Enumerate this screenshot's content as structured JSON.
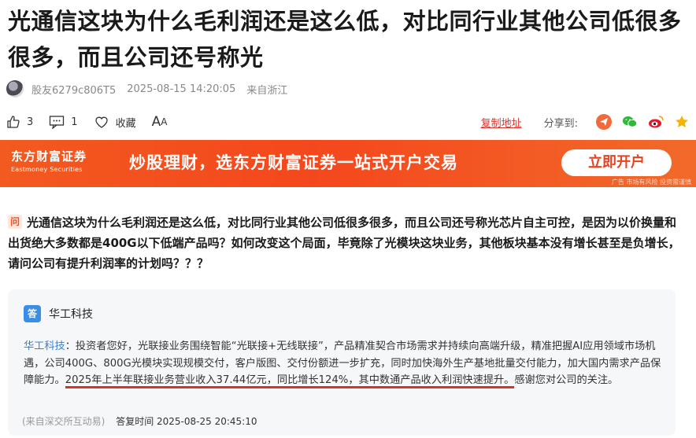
{
  "article": {
    "title": "光通信这块为什么毛利润还是这么低，对比同行业其他公司低很多很多，而且公司还号称光"
  },
  "meta": {
    "author": "股友6279c806T5",
    "datetime": "2025-08-15 14:20:05",
    "location": "来自浙江"
  },
  "actions": {
    "likes": "3",
    "comments": "1",
    "favorite_label": "收藏",
    "font_label": "A",
    "font_label_small": "A",
    "copy_link": "复制地址",
    "share_label": "分享到:"
  },
  "share_icons": [
    {
      "name": "paper-plane-icon",
      "color": "#f06a3c"
    },
    {
      "name": "wechat-icon",
      "color": "#2dbb35"
    },
    {
      "name": "weibo-icon",
      "color": "#e6162d"
    },
    {
      "name": "qzone-star-icon",
      "color": "#f4b400"
    }
  ],
  "banner": {
    "logo_cn": "东方财富证券",
    "logo_en": "Eastmoney Securities",
    "slogan": "炒股理财，选东方财富证券一站式开户交易",
    "button": "立即开户",
    "ad_note": "广告 市场有风险 投资需谨慎"
  },
  "question": {
    "badge": "问",
    "text": "光通信这块为什么毛利润还是这么低，对比同行业其他公司低很多很多，而且公司还号称光芯片自主可控，是因为以价换量和出货绝大多数都是400G以下低端产品吗？如何改变这个局面，毕竟除了光模块这块业务，其他板块基本没有增长甚至是负增长，请问公司有提升利润率的计划吗？？？"
  },
  "answer": {
    "badge": "答",
    "company": "华工科技",
    "company_link": "华工科技",
    "text_before": "：投资者您好，光联接业务围绕智能“光联接+无线联接”，产品精准契合市场需求并持续向高端升级，精准把握AI应用领域市场机遇，公司400G、800G光模块实现规模交付，客户版图、交付份额进一步扩充，同时加快海外生产基地批量交付能力，加大国内需求产品保障能力。",
    "text_highlight": "2025年上半年联接业务营业收入37.44亿元，同比增长124%，其中数通产品收入利润快速提升。",
    "text_after": "感谢您对公司的关注。",
    "source": "(来自深交所互动易)",
    "answer_time": "答复时间 2025-08-25 20:45:10"
  },
  "colors": {
    "accent_red": "#d9302c",
    "banner_orange": "#f4471d",
    "link_blue": "#3a7fd5"
  }
}
